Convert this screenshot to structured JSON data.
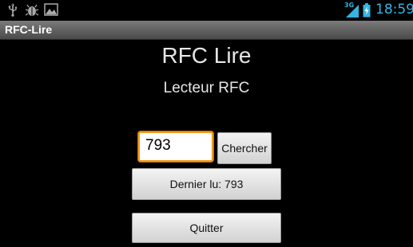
{
  "status_bar": {
    "network_type": "3G",
    "time": "18:59",
    "accent_color": "#33b5e5",
    "left_icons": [
      "usb-icon",
      "debug-icon",
      "gallery-icon"
    ],
    "right_icons": [
      "signal-icon",
      "battery-icon"
    ]
  },
  "title_bar": {
    "title": "RFC-Lire"
  },
  "main": {
    "heading": "RFC Lire",
    "subheading": "Lecteur RFC",
    "search_value": "793",
    "search_button_label": "Chercher",
    "last_read_button_label": "Dernier lu: 793",
    "quit_button_label": "Quitter"
  },
  "colors": {
    "background": "#000000",
    "input_focus_border": "#f29a1a"
  }
}
